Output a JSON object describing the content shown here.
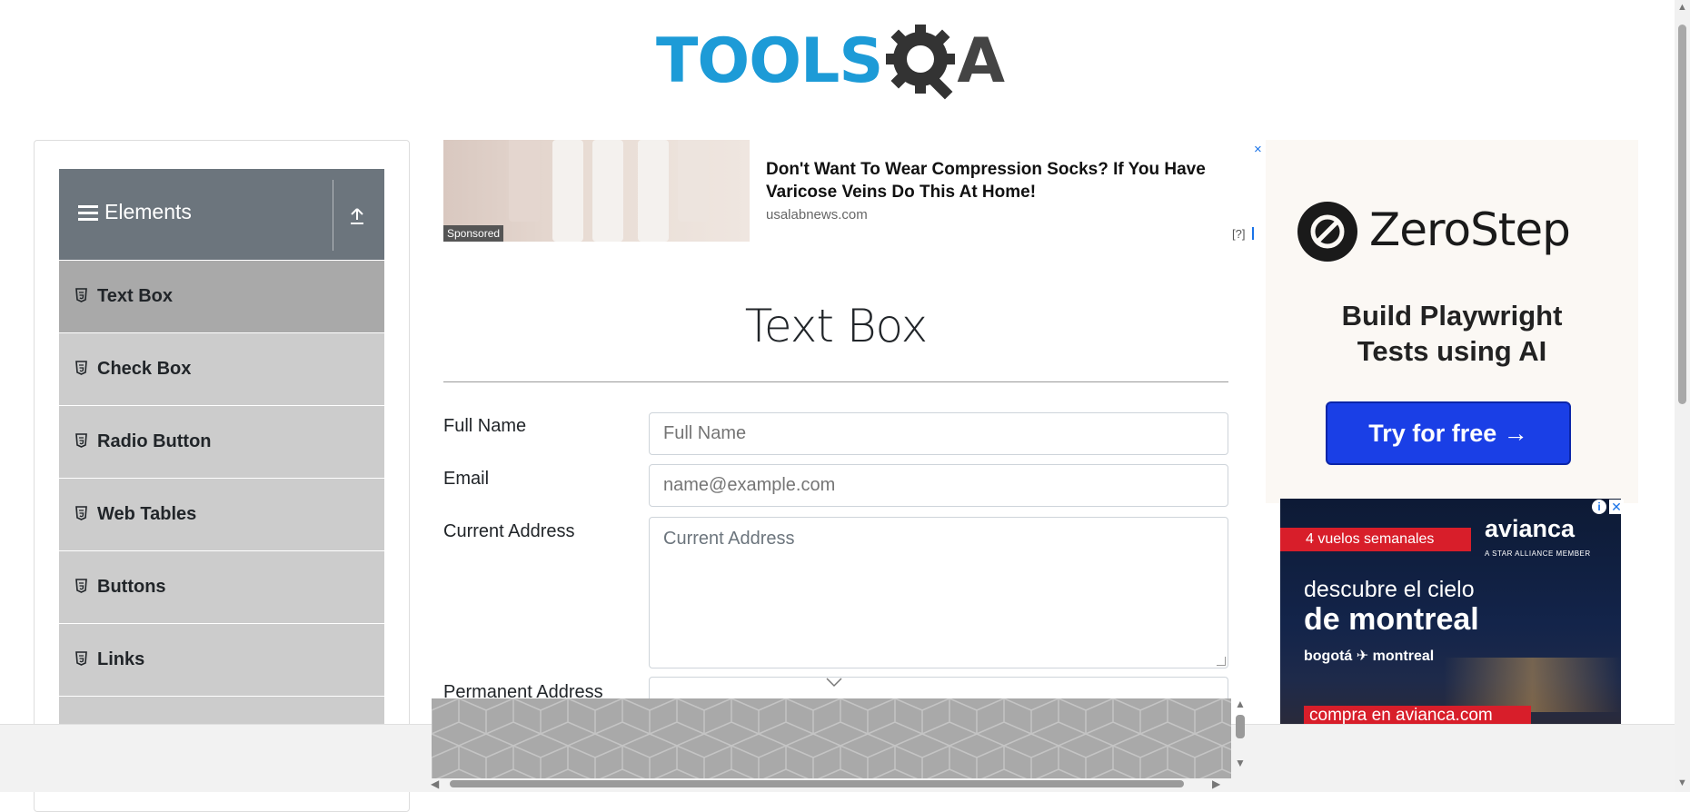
{
  "header": {
    "logo_text_1": "TOOLS",
    "logo_text_2": "A"
  },
  "sidebar": {
    "group_title": "Elements",
    "items": [
      {
        "label": "Text Box",
        "active": true
      },
      {
        "label": "Check Box",
        "active": false
      },
      {
        "label": "Radio Button",
        "active": false
      },
      {
        "label": "Web Tables",
        "active": false
      },
      {
        "label": "Buttons",
        "active": false
      },
      {
        "label": "Links",
        "active": false
      }
    ]
  },
  "top_ad": {
    "headline": "Don't Want To Wear Compression Socks? If You Have Varicose Veins Do This At Home!",
    "domain": "usalabnews.com",
    "sponsored": "Sponsored",
    "close": "×",
    "help": "[?]"
  },
  "main": {
    "title": "Text Box",
    "fields": {
      "full_name_label": "Full Name",
      "full_name_placeholder": "Full Name",
      "email_label": "Email",
      "email_placeholder": "name@example.com",
      "current_address_label": "Current Address",
      "current_address_placeholder": "Current Address",
      "permanent_address_label": "Permanent Address"
    }
  },
  "right_ad": {
    "brand": "ZeroStep",
    "tagline_1": "Build Playwright",
    "tagline_2": "Tests using AI",
    "cta": "Try for free →"
  },
  "avianca_ad": {
    "badge": "4 vuelos semanales",
    "brand": "avianca",
    "member": "A STAR ALLIANCE MEMBER",
    "line1": "descubre el cielo",
    "line2": "de montreal",
    "route": "bogotá ✈ montreal",
    "cta": "compra en avianca.com"
  },
  "colors": {
    "accent_blue": "#1d9bd7",
    "sidebar_header": "#6c757d",
    "active_item": "#a9a9a9",
    "item": "#cccccc"
  }
}
